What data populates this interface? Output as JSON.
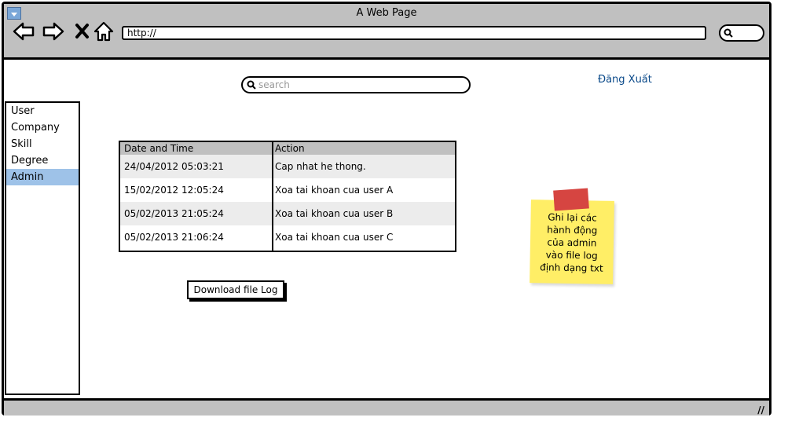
{
  "window": {
    "title": "A Web Page"
  },
  "browser": {
    "address": "http://",
    "nav": [
      "back-icon",
      "forward-icon",
      "stop-icon",
      "home-icon"
    ]
  },
  "search": {
    "placeholder": "search"
  },
  "header": {
    "logout_label": "Đăng Xuất"
  },
  "sidebar": {
    "items": [
      {
        "label": "User"
      },
      {
        "label": "Company"
      },
      {
        "label": "Skill"
      },
      {
        "label": "Degree"
      },
      {
        "label": "Admin",
        "selected": true
      }
    ]
  },
  "log_table": {
    "columns": [
      "Date and Time",
      "Action"
    ],
    "rows": [
      {
        "datetime": "24/04/2012 05:03:21",
        "action": "Cap nhat he thong."
      },
      {
        "datetime": "15/02/2012 12:05:24",
        "action": "Xoa tai khoan cua user A"
      },
      {
        "datetime": "05/02/2013 21:05:24",
        "action": "Xoa tai khoan cua user B"
      },
      {
        "datetime": "05/02/2013 21:06:24",
        "action": "Xoa tai khoan cua user C"
      }
    ]
  },
  "download_button": {
    "label": "Download file Log"
  },
  "sticky_note": {
    "text": "Ghi lại các\nhành động\ncủa admin\nvào file log\nđịnh dạng txt"
  },
  "colors": {
    "selected_item": "#9ec2e8",
    "link": "#0b4a8a",
    "note": "#ffee66",
    "tape": "#d64541",
    "chrome": "#c0c0c0"
  }
}
